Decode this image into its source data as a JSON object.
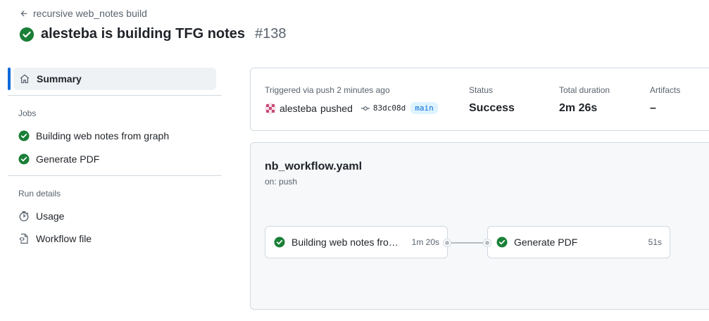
{
  "header": {
    "back_label": "recursive web_notes build",
    "title": "alesteba is building TFG notes",
    "run_number": "#138"
  },
  "sidebar": {
    "summary_label": "Summary",
    "jobs_heading": "Jobs",
    "jobs": [
      {
        "label": "Building web notes from graph"
      },
      {
        "label": "Generate PDF"
      }
    ],
    "run_details_heading": "Run details",
    "details": [
      {
        "label": "Usage",
        "icon": "stopwatch-icon"
      },
      {
        "label": "Workflow file",
        "icon": "file-code-icon"
      }
    ]
  },
  "summary": {
    "triggered_label": "Triggered via push 2 minutes ago",
    "actor": "alesteba",
    "action": "pushed",
    "commit": "83dc08d",
    "branch": "main",
    "status_label": "Status",
    "status_value": "Success",
    "duration_label": "Total duration",
    "duration_value": "2m 26s",
    "artifacts_label": "Artifacts",
    "artifacts_value": "–"
  },
  "workflow": {
    "file_name": "nb_workflow.yaml",
    "trigger": "on: push",
    "jobs": [
      {
        "name": "Building web notes from graph",
        "display_name": "Building web notes from ...",
        "duration": "1m 20s"
      },
      {
        "name": "Generate PDF",
        "display_name": "Generate PDF",
        "duration": "51s"
      }
    ]
  },
  "colors": {
    "success": "#1a7f37",
    "accent": "#0969da",
    "border": "#d1d9e0"
  }
}
